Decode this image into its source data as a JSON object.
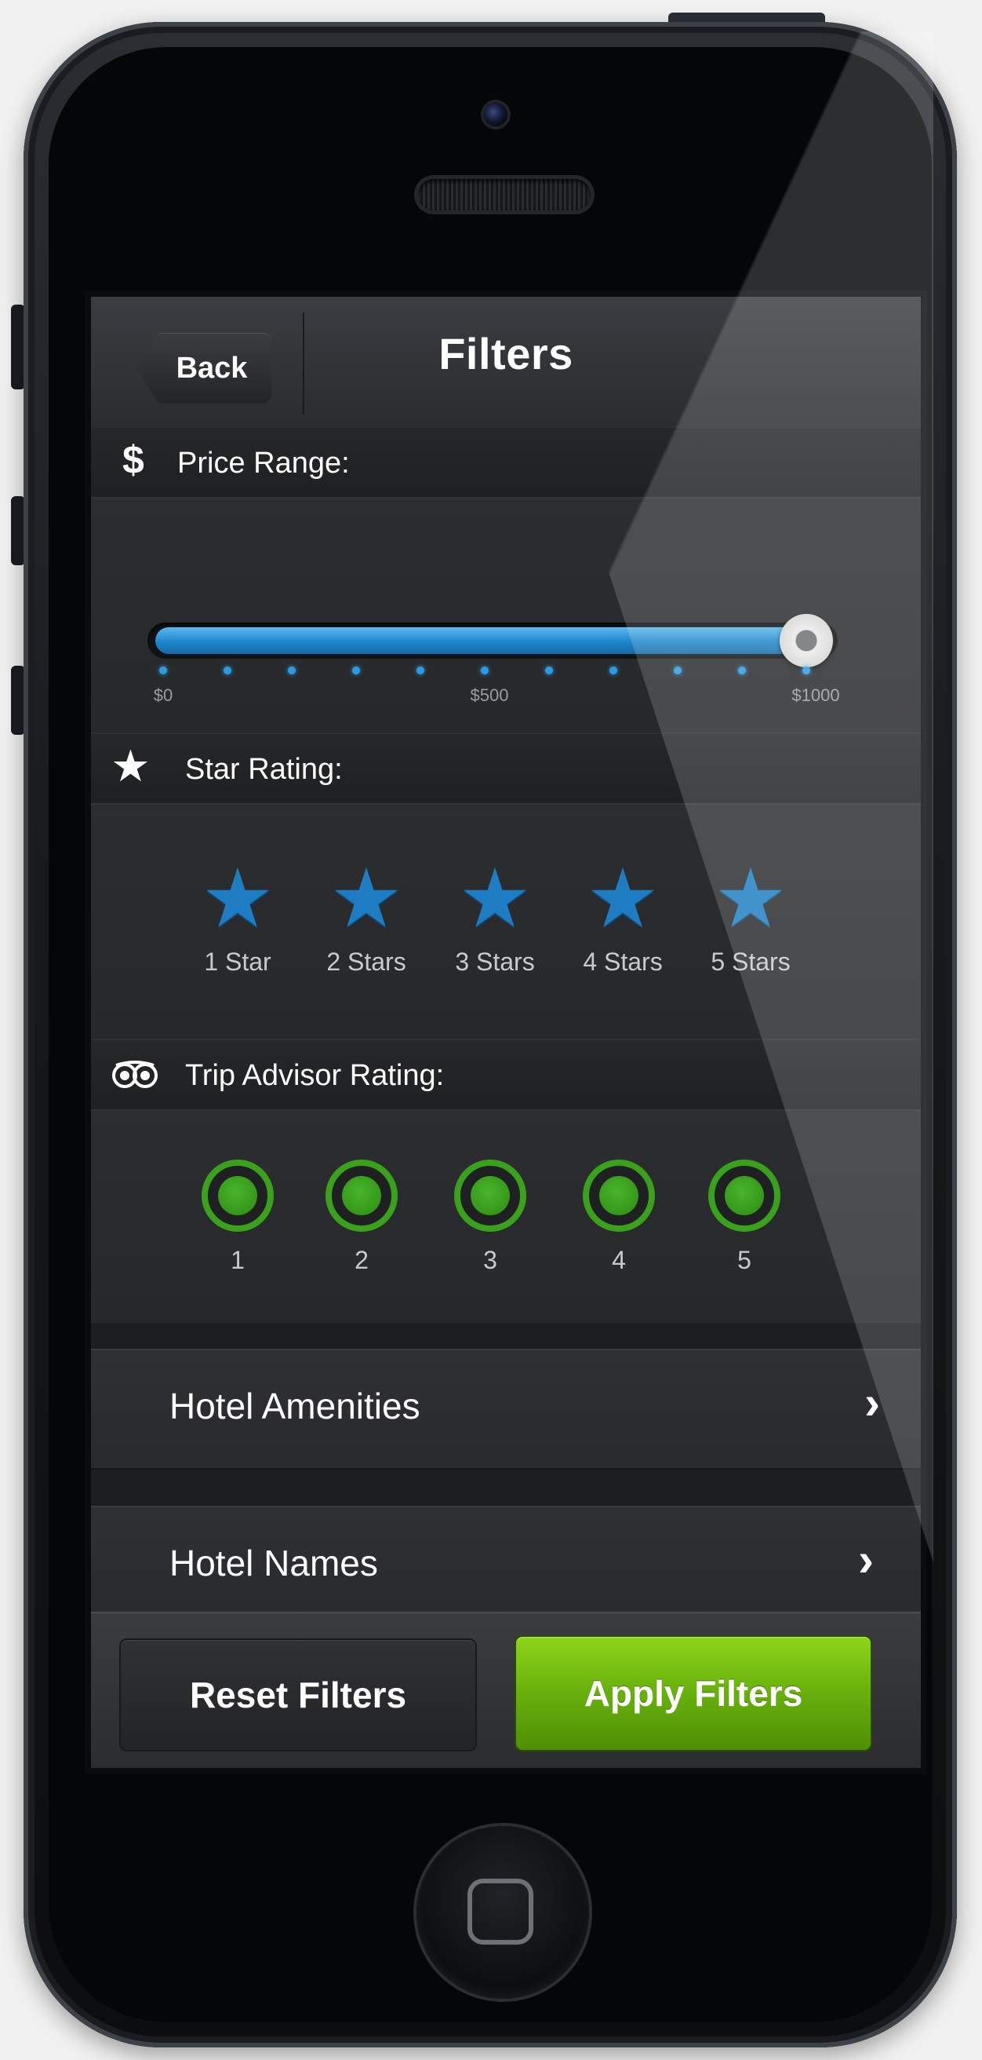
{
  "navbar": {
    "title": "Filters",
    "back_label": "Back"
  },
  "price_range": {
    "icon": "$",
    "label": "Price Range:",
    "min_label": "$0",
    "mid_label": "$500",
    "max_label": "$1000",
    "min": 0,
    "max": 1000,
    "value": 1000,
    "accent": "#2b9be2"
  },
  "star_rating": {
    "icon": "★",
    "label": "Star Rating:",
    "star_glyph": "★",
    "items": [
      "1 Star",
      "2 Stars",
      "3 Stars",
      "4 Stars",
      "5 Stars"
    ],
    "accent": "#1e7dc2"
  },
  "trip_advisor": {
    "icon": "tripadvisor-owl-icon",
    "label": "Trip Advisor Rating:",
    "items": [
      "1",
      "2",
      "3",
      "4",
      "5"
    ],
    "accent": "#3aa11d"
  },
  "rows": {
    "hotel_amenities": "Hotel Amenities",
    "hotel_names": "Hotel Names",
    "chevron": "›"
  },
  "actions": {
    "reset_label": "Reset Filters",
    "apply_label": "Apply Filters",
    "apply_color": "#67b00c"
  }
}
